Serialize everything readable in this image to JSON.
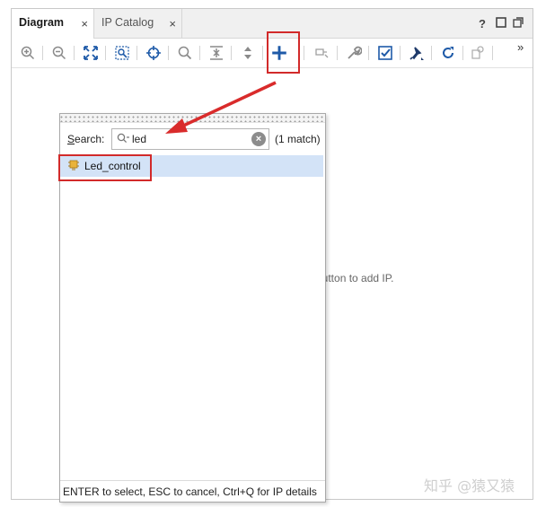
{
  "tabs": [
    {
      "label": "Diagram",
      "close": "×"
    },
    {
      "label": "IP Catalog",
      "close": "×"
    }
  ],
  "window_controls": {
    "help": "?",
    "maximize": "☐",
    "restore": "⧉"
  },
  "toolbar": {
    "overflow": "»",
    "icons": [
      "zoom-in-icon",
      "zoom-out-icon",
      "fit-view-icon",
      "zoom-area-icon",
      "auto-connect-icon",
      "search-icon",
      "collapse-icon",
      "expand-icon",
      "add-ip-icon",
      "port-icon",
      "wrench-icon",
      "validate-icon",
      "pin-icon",
      "refresh-icon",
      "regenerate-icon"
    ]
  },
  "canvas": {
    "hint": "button to add IP."
  },
  "popup": {
    "search_label_prefix": "S",
    "search_label_rest": "earch:",
    "search_value": "led",
    "clear": "×",
    "match_count": "(1 match)",
    "results": [
      {
        "label": "Led_control"
      }
    ],
    "footer": "ENTER to select, ESC to cancel, Ctrl+Q for IP details"
  },
  "colors": {
    "highlight": "#d22a2a",
    "selection": "#d3e3f7",
    "accent_blue": "#1e5aa8"
  },
  "watermark": "知乎 @猿又猿"
}
